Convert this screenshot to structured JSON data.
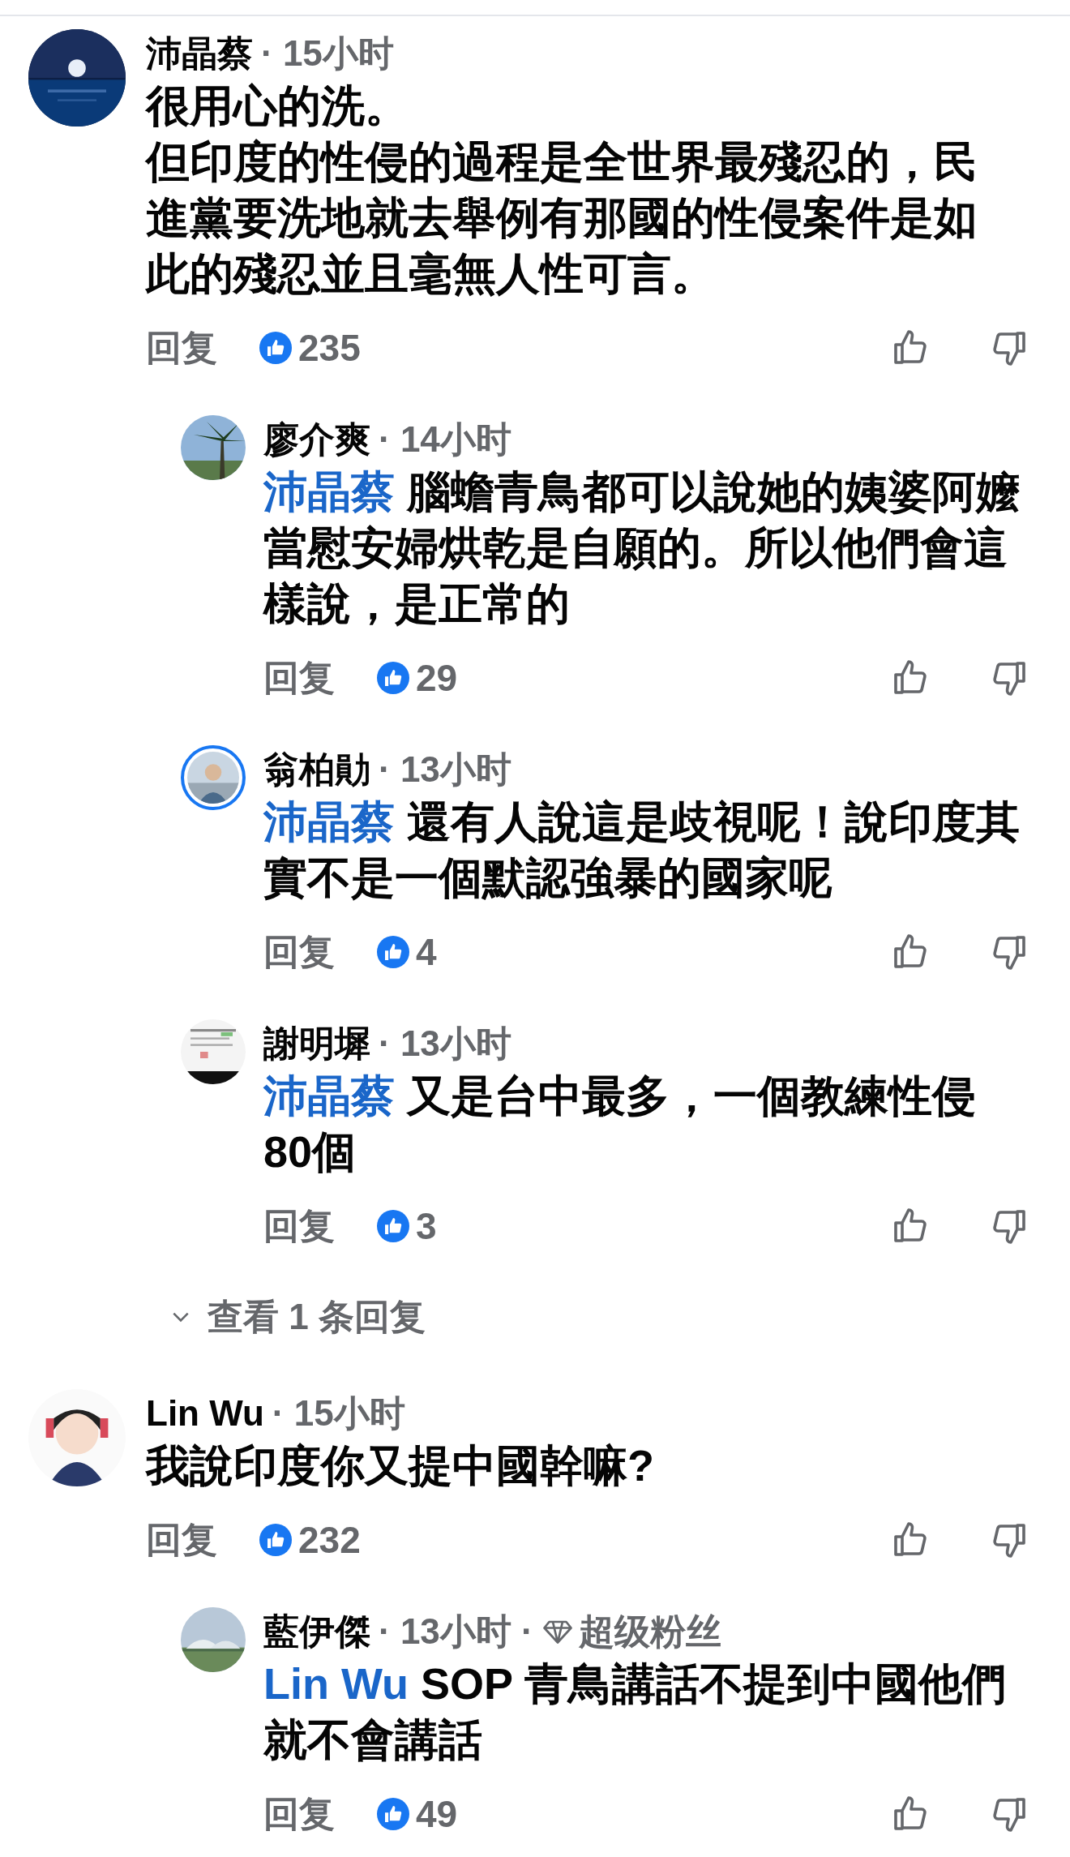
{
  "comments": [
    {
      "author": "沛晶蔡",
      "time": "· 15小时",
      "paragraphs": [
        "很用心的洗。",
        "但印度的性侵的過程是全世界最殘忍的，民進黨要洗地就去舉例有那國的性侵案件是如此的殘忍並且毫無人性可言。"
      ],
      "reply_label": "回复",
      "likes": "235",
      "replies": [
        {
          "author": "廖介爽",
          "time": "· 14小时",
          "story_ring": false,
          "mention": "沛晶蔡",
          "text": "腦蟾青鳥都可以說她的姨婆阿嬤當慰安婦烘乾是自願的。所以他們會這樣說，是正常的",
          "reply_label": "回复",
          "likes": "29"
        },
        {
          "author": "翁柏勛",
          "time": "· 13小时",
          "story_ring": true,
          "mention": "沛晶蔡",
          "text": "還有人說這是歧視呢！說印度其實不是一個默認強暴的國家呢",
          "reply_label": "回复",
          "likes": "4"
        },
        {
          "author": "謝明墀",
          "time": "· 13小时",
          "story_ring": false,
          "mention": "沛晶蔡",
          "text": "又是台中最多，一個教練性侵 80個",
          "reply_label": "回复",
          "likes": "3"
        }
      ],
      "more_replies": "查看 1 条回复"
    },
    {
      "author": "Lin Wu",
      "time": "· 15小时",
      "paragraphs": [
        "我說印度你又提中國幹嘛?"
      ],
      "reply_label": "回复",
      "likes": "232",
      "replies": [
        {
          "author": "藍伊傑",
          "time": "· 13小时 ·",
          "badge": "超级粉丝",
          "story_ring": false,
          "mention": "Lin Wu",
          "text": "SOP 青鳥講話不提到中國他們就不會講話",
          "reply_label": "回复",
          "likes": "49"
        }
      ]
    }
  ]
}
